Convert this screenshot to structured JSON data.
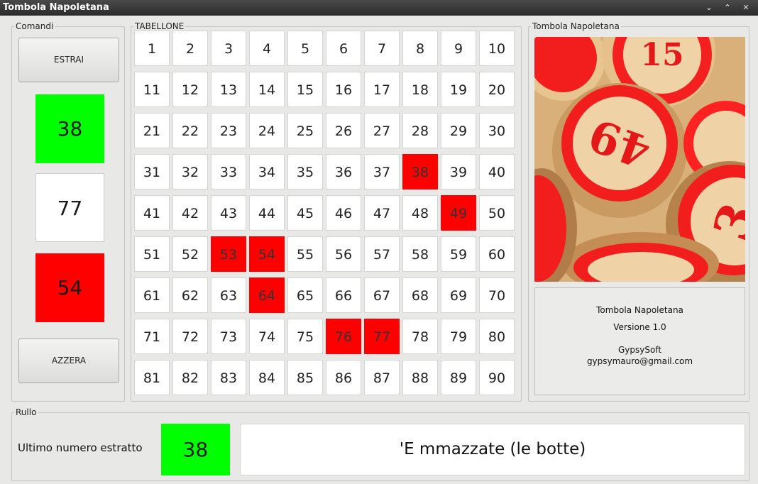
{
  "window": {
    "title": "Tombola Napoletana"
  },
  "comandi": {
    "title": "Comandi",
    "estrai_label": "ESTRAI",
    "azzera_label": "AZZERA",
    "boxes": [
      {
        "value": "38",
        "color": "#00ff00"
      },
      {
        "value": "77",
        "color": "#ffffff"
      },
      {
        "value": "54",
        "color": "#ff0000"
      }
    ]
  },
  "tabellone": {
    "title": "TABELLONE",
    "numbers": [
      1,
      2,
      3,
      4,
      5,
      6,
      7,
      8,
      9,
      10,
      11,
      12,
      13,
      14,
      15,
      16,
      17,
      18,
      19,
      20,
      21,
      22,
      23,
      24,
      25,
      26,
      27,
      28,
      29,
      30,
      31,
      32,
      33,
      34,
      35,
      36,
      37,
      38,
      39,
      40,
      41,
      42,
      43,
      44,
      45,
      46,
      47,
      48,
      49,
      50,
      51,
      52,
      53,
      54,
      55,
      56,
      57,
      58,
      59,
      60,
      61,
      62,
      63,
      64,
      65,
      66,
      67,
      68,
      69,
      70,
      71,
      72,
      73,
      74,
      75,
      76,
      77,
      78,
      79,
      80,
      81,
      82,
      83,
      84,
      85,
      86,
      87,
      88,
      89,
      90
    ],
    "extracted": [
      38,
      49,
      53,
      54,
      64,
      76,
      77
    ],
    "highlight_color": "#ff0000"
  },
  "info": {
    "title": "Tombola Napoletana",
    "image": "tombola-balls-photo",
    "app_name": "Tombola Napoletana",
    "version": "Versione 1.0",
    "author": "GypsySoft",
    "email": "gypsymauro@gmail.com"
  },
  "rullo": {
    "title": "Rullo",
    "label": "Ultimo numero estratto",
    "last_number": "38",
    "last_color": "#00ff00",
    "phrase": "'E mmazzate (le botte)"
  }
}
